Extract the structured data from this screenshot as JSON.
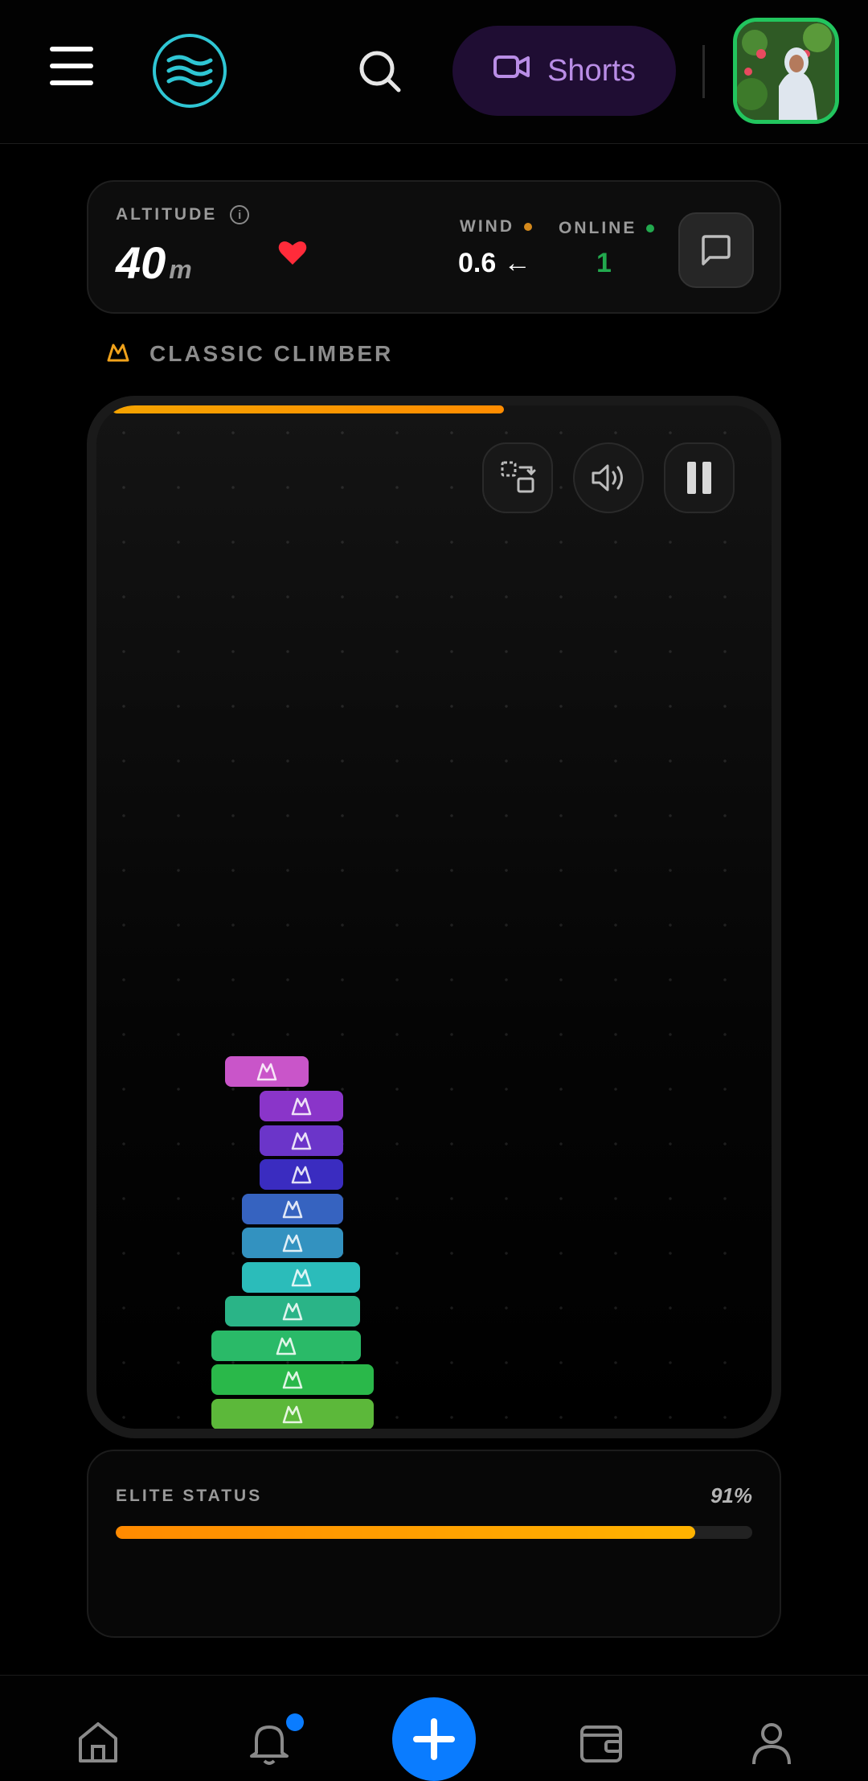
{
  "header": {
    "shorts_label": "Shorts",
    "icons": [
      "menu-icon",
      "brand-wave-icon",
      "search-icon",
      "video-camera-icon",
      "profile-avatar"
    ]
  },
  "stats": {
    "altitude_label": "ALTITUDE",
    "altitude_value": "40",
    "altitude_unit": "m",
    "wind_label": "WIND",
    "wind_value": "0.6 ←",
    "online_label": "ONLINE",
    "online_value": "1",
    "colors": {
      "wind_dot": "#d4891c",
      "online_dot": "#22a94e",
      "online_value": "#22a94e",
      "heart": "#ff2b3a"
    }
  },
  "mode": {
    "label": "CLASSIC CLIMBER"
  },
  "game": {
    "top_progress": 0.58,
    "controls": [
      "swap-icon",
      "volume-icon",
      "pause-icon"
    ],
    "falling_block_color": "#c955c9",
    "stack_colors": [
      "#8a35c9",
      "#6b35c9",
      "#3a2cc0",
      "#3663c0",
      "#3392c0",
      "#2bbcba",
      "#2ab487",
      "#2aba68",
      "#2ab84a",
      "#5cb83a"
    ]
  },
  "elite": {
    "label": "ELITE STATUS",
    "percent_text": "91%",
    "percent": 91
  },
  "nav": {
    "items": [
      "home-icon",
      "bell-icon",
      "add-icon",
      "wallet-icon",
      "profile-icon"
    ],
    "accent": "#0a7cff"
  }
}
